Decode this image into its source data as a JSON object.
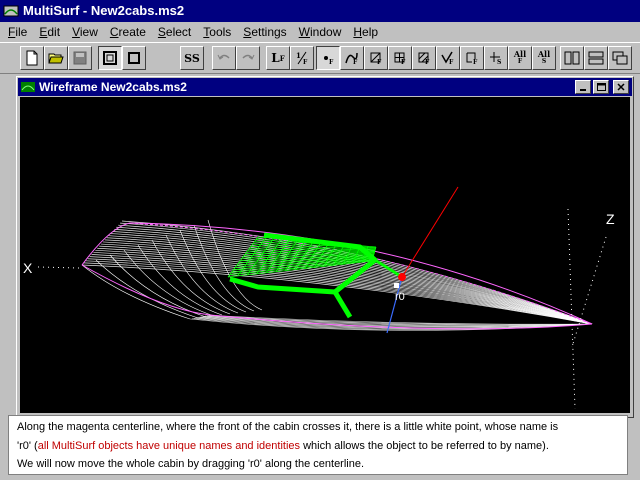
{
  "app": {
    "title": "MultiSurf - New2cabs.ms2"
  },
  "menu": {
    "items": [
      {
        "u": "F",
        "rest": "ile"
      },
      {
        "u": "E",
        "rest": "dit"
      },
      {
        "u": "V",
        "rest": "iew"
      },
      {
        "u": "C",
        "rest": "reate"
      },
      {
        "u": "S",
        "rest": "elect"
      },
      {
        "u": "T",
        "rest": "ools"
      },
      {
        "u": "S",
        "rest": "ettings"
      },
      {
        "u": "W",
        "rest": "indow"
      },
      {
        "u": "H",
        "rest": "elp"
      }
    ]
  },
  "toolbar": {
    "ss_label": "SS",
    "l_label": "L",
    "all_a_label": "All",
    "all_b_label": "All",
    "sub_f": "F",
    "sub_s": "S"
  },
  "window": {
    "title": "Wireframe New2cabs.ms2"
  },
  "viewport": {
    "axis_x": "X",
    "axis_z": "Z",
    "point_label": "r0",
    "colors": {
      "background": "#000000",
      "hull": "#ffffff",
      "cabin": "#00ff00",
      "centerline": "#ff66ff",
      "axis_red": "#ff0000",
      "axis_blue": "#3a6cff"
    }
  },
  "tutorial": {
    "line1": "Along the magenta centerline, where the front of the cabin crosses it, there is a little white point, whose name is",
    "line2_a": "'r0' (",
    "line2_red": "all MultiSurf objects have unique names and identities",
    "line2_b": " which allows the object to be referred to by name).",
    "line3": "We will now move the whole cabin by dragging 'r0' along the centerline.",
    "accent": "#c00000"
  }
}
